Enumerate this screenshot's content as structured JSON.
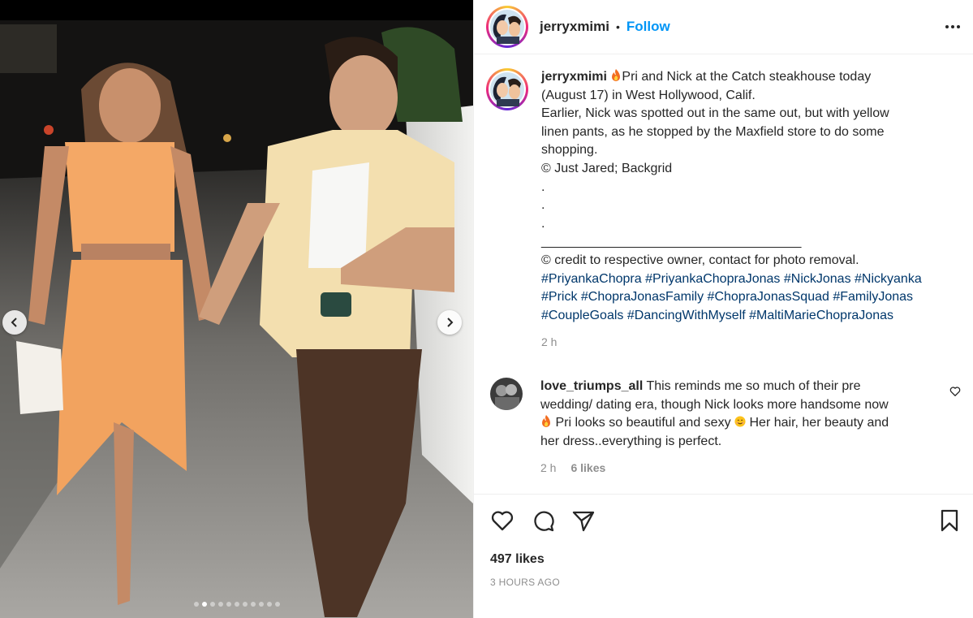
{
  "post": {
    "username": "jerryxmimi",
    "separator": "•",
    "follow_label": "Follow",
    "more_icon": "more-options-icon"
  },
  "caption": {
    "username": "jerryxmimi",
    "lines": [
      "Pri and Nick at the Catch steakhouse today",
      "(August 17) in West Hollywood, Calif.",
      "Earlier,  Nick was spotted out in the same out, but with yellow",
      "linen pants, as he stopped by the Maxfield store to do some",
      "shopping.",
      "© Just Jared; Backgrid",
      ".",
      ".",
      ".",
      "____________________________________",
      "© credit to respective owner, contact for photo removal."
    ],
    "hashtags": [
      [
        "#PriyankaChopra",
        "#PriyankaChopraJonas",
        "#NickJonas",
        "#Nickyanka"
      ],
      [
        "#Prick",
        "#ChopraJonasFamily",
        "#ChopraJonasSquad",
        "#FamilyJonas"
      ],
      [
        "#CoupleGoals",
        "#DancingWithMyself",
        "#MaltiMarieChopraJonas"
      ]
    ],
    "time": "2 h"
  },
  "comment": {
    "username": "love_triumps_all",
    "lines": [
      "This reminds me so much of their pre",
      "wedding/ dating era, though Nick looks more handsome now",
      "Pri looks so beautiful and sexy",
      "Her hair, her beauty and",
      "her dress..everything is perfect."
    ],
    "time": "2 h",
    "likes": "6 likes"
  },
  "footer": {
    "likes": "497 likes",
    "time_ago": "3 HOURS AGO"
  },
  "carousel": {
    "dot_count": 11,
    "active_index": 1
  },
  "colors": {
    "accent": "#0095f6",
    "hashtag": "#00376b",
    "muted": "#8e8e8e",
    "text": "#262626"
  }
}
